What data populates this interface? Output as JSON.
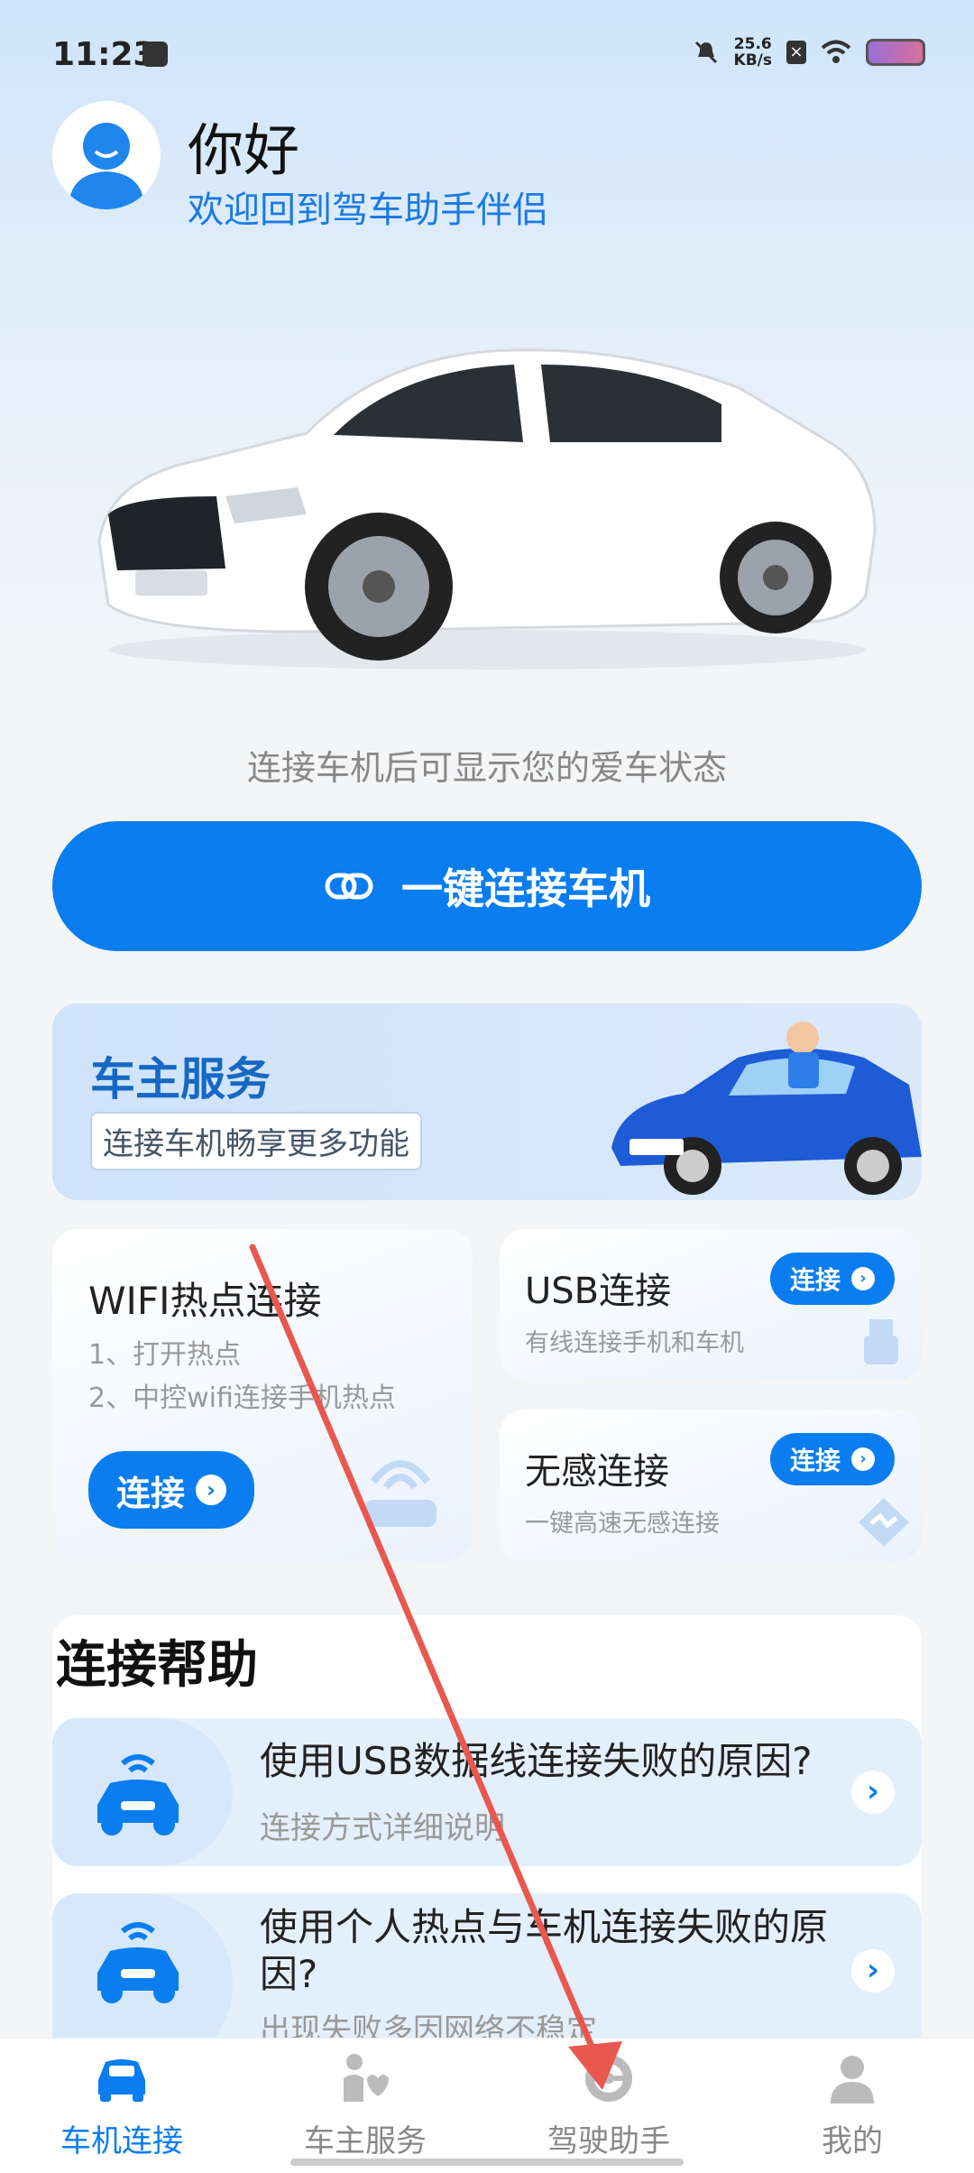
{
  "status_bar": {
    "time": "11:23",
    "speed_value": "25.6",
    "speed_unit": "KB/s",
    "icons": [
      "message-icon",
      "mute-bell-icon",
      "x-icon",
      "wifi-icon",
      "battery-icon"
    ]
  },
  "header": {
    "greeting": "你好",
    "welcome": "欢迎回到驾车助手伴侣"
  },
  "hint": "连接车机后可显示您的爱车状态",
  "connect_button": "一键连接车机",
  "owner_banner": {
    "title": "车主服务",
    "tag": "连接车机畅享更多功能"
  },
  "wifi_card": {
    "title": "WIFI热点连接",
    "step1": "1、打开热点",
    "step2": "2、中控wifi连接手机热点",
    "button": "连接"
  },
  "usb_card": {
    "title": "USB连接",
    "desc": "有线连接手机和车机",
    "button": "连接"
  },
  "wugan_card": {
    "title": "无感连接",
    "desc": "一键高速无感连接",
    "button": "连接"
  },
  "help": {
    "title": "连接帮助",
    "items": [
      {
        "question": "使用USB数据线连接失败的原因?",
        "answer": "连接方式详细说明"
      },
      {
        "question": "使用个人热点与车机连接失败的原因?",
        "answer": "出现失败多因网络不稳定"
      }
    ]
  },
  "tabs": [
    {
      "label": "车机连接",
      "icon": "car-icon",
      "active": true
    },
    {
      "label": "车主服务",
      "icon": "service-icon",
      "active": false
    },
    {
      "label": "驾驶助手",
      "icon": "steering-wheel-icon",
      "active": false
    },
    {
      "label": "我的",
      "icon": "person-icon",
      "active": false
    }
  ],
  "colors": {
    "primary": "#0a7df1",
    "annotation_arrow": "#e8584e"
  }
}
